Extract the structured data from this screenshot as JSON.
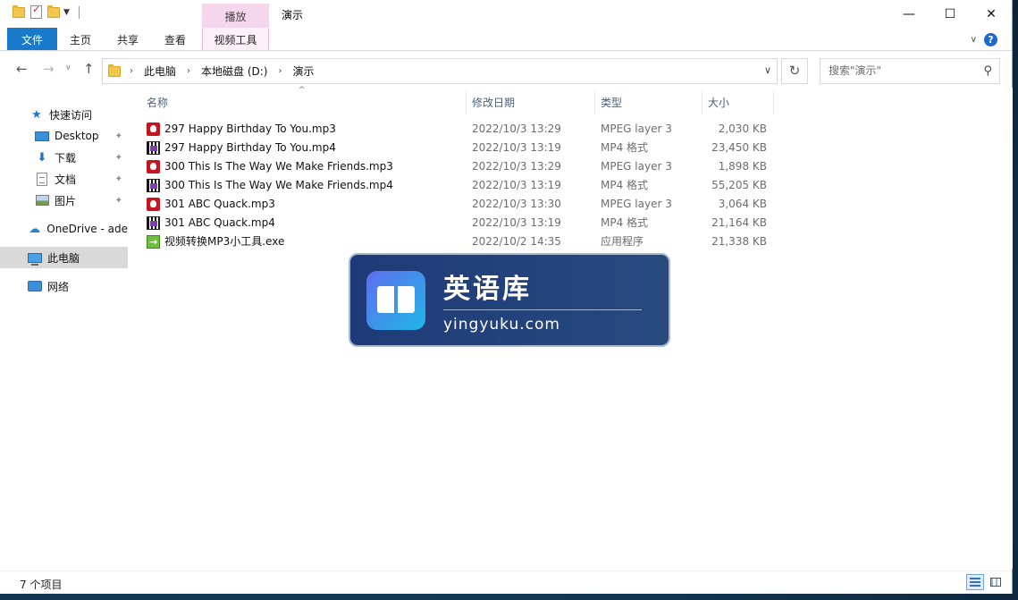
{
  "titlebar": {
    "context_tab": "播放",
    "title": "演示",
    "minimize": "—",
    "maximize": "☐",
    "close": "✕"
  },
  "ribbon": {
    "tabs": [
      "文件",
      "主页",
      "共享",
      "查看",
      "视频工具"
    ],
    "help": "?"
  },
  "address": {
    "crumbs": [
      "此电脑",
      "本地磁盘 (D:)",
      "演示"
    ],
    "search_placeholder": "搜索\"演示\""
  },
  "sidebar": {
    "items": [
      {
        "label": "快速访问",
        "icon": "star-icon"
      },
      {
        "label": "Desktop",
        "icon": "desktop-icon",
        "pinned": true
      },
      {
        "label": "下载",
        "icon": "download-icon",
        "pinned": true
      },
      {
        "label": "文档",
        "icon": "document-icon",
        "pinned": true
      },
      {
        "label": "图片",
        "icon": "pictures-icon",
        "pinned": true
      },
      {
        "label": "OneDrive - ade",
        "icon": "onedrive-icon"
      },
      {
        "label": "此电脑",
        "icon": "this-pc-icon",
        "selected": true
      },
      {
        "label": "网络",
        "icon": "network-icon"
      }
    ]
  },
  "columns": {
    "name": "名称",
    "date": "修改日期",
    "type": "类型",
    "size": "大小"
  },
  "files": [
    {
      "name": "297 Happy Birthday To You.mp3",
      "date": "2022/10/3 13:29",
      "type": "MPEG layer 3",
      "size": "2,030 KB",
      "icon": "mp3-icon"
    },
    {
      "name": "297 Happy Birthday To You.mp4",
      "date": "2022/10/3 13:19",
      "type": "MP4 格式",
      "size": "23,450 KB",
      "icon": "mp4-icon"
    },
    {
      "name": "300 This Is The Way We Make Friends.mp3",
      "date": "2022/10/3 13:29",
      "type": "MPEG layer 3",
      "size": "1,898 KB",
      "icon": "mp3-icon"
    },
    {
      "name": "300 This Is The Way We Make Friends.mp4",
      "date": "2022/10/3 13:19",
      "type": "MP4 格式",
      "size": "55,205 KB",
      "icon": "mp4-icon"
    },
    {
      "name": "301 ABC Quack.mp3",
      "date": "2022/10/3 13:30",
      "type": "MPEG layer 3",
      "size": "3,064 KB",
      "icon": "mp3-icon"
    },
    {
      "name": "301 ABC Quack.mp4",
      "date": "2022/10/3 13:19",
      "type": "MP4 格式",
      "size": "21,164 KB",
      "icon": "mp4-icon"
    },
    {
      "name": "视频转换MP3小工具.exe",
      "date": "2022/10/2 14:35",
      "type": "应用程序",
      "size": "21,338 KB",
      "icon": "exe-icon"
    }
  ],
  "status": {
    "count": "7 个项目"
  },
  "watermark": {
    "title": "英语库",
    "url": "yingyuku.com"
  }
}
